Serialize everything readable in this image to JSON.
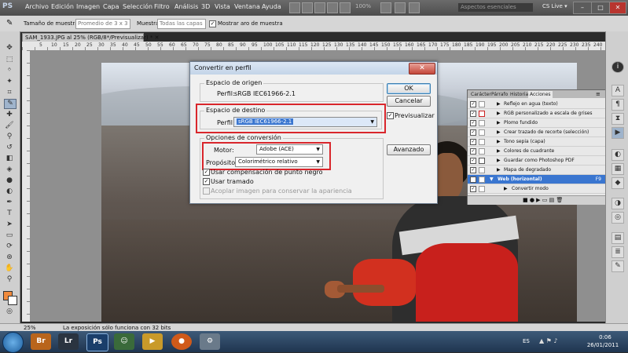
{
  "app": {
    "logo": "PS",
    "menu": [
      "Archivo",
      "Edición",
      "Imagen",
      "Capa",
      "Selección",
      "Filtro",
      "Análisis",
      "3D",
      "Vista",
      "Ventana",
      "Ayuda"
    ],
    "zoom": "100%",
    "workspace": "Aspectos esenciales",
    "cs_live": "CS Live ▾",
    "win_minimize": "–",
    "win_maximize": "□",
    "win_close": "✕"
  },
  "options": {
    "sample_size_label": "Tamaño de muestra:",
    "sample_size_value": "Promedio de 3 x 3",
    "sample_label": "Muestra:",
    "sample_value": "Todas las capas",
    "ring_label": "Mostrar aro de muestra",
    "ring_checked": "✓"
  },
  "document": {
    "tab": "SAM_1933.JPG al 25% (RGB/8*/Previsualizar) * ✕",
    "ruler_numbers": [
      "5",
      "10",
      "15",
      "20",
      "25",
      "30",
      "35",
      "40",
      "45",
      "50",
      "55",
      "60",
      "65",
      "70",
      "75",
      "80",
      "85",
      "90",
      "95",
      "100",
      "105",
      "110",
      "115",
      "120",
      "125",
      "130",
      "135",
      "140",
      "145",
      "150",
      "155",
      "160",
      "165",
      "170",
      "175",
      "180",
      "185",
      "190",
      "195",
      "200",
      "205",
      "210",
      "215",
      "220",
      "225",
      "230",
      "235",
      "240",
      "245"
    ]
  },
  "dialog": {
    "title": "Convertir en perfil",
    "close": "✕",
    "source_group": "Espacio de origen",
    "source_profile_label": "Perfil:",
    "source_profile_value": "sRGB IEC61966-2.1",
    "dest_group": "Espacio de destino",
    "dest_profile_label": "Perfil:",
    "dest_profile_value": "sRGB IEC61966-2.1",
    "conv_group": "Opciones de conversión",
    "engine_label": "Motor:",
    "engine_value": "Adobe (ACE)",
    "intent_label": "Propósito:",
    "intent_value": "Colorimétrico relativo",
    "bpc_label": "Usar compensación de punto negro",
    "dither_label": "Usar tramado",
    "flatten_label": "Acoplar imagen para conservar la apariencia",
    "ok": "OK",
    "cancel": "Cancelar",
    "preview_label": "Previsualizar",
    "advanced": "Avanzado",
    "check": "✓"
  },
  "actions_panel": {
    "tabs": [
      "Carácter",
      "Párrafo",
      "Historia",
      "Acciones"
    ],
    "items": [
      {
        "label": "Reflejo en agua (texto)",
        "tri": "▶"
      },
      {
        "label": "RGB personalizado a escala de grises",
        "tri": "▶"
      },
      {
        "label": "Plomo fundido",
        "tri": "▶"
      },
      {
        "label": "Crear trazado de recorte (selección)",
        "tri": "▶"
      },
      {
        "label": "Tono sepia (capa)",
        "tri": "▶"
      },
      {
        "label": "Colores de cuadrante",
        "tri": "▶"
      },
      {
        "label": "Guardar como Photoshop PDF",
        "tri": "▶"
      },
      {
        "label": "Mapa de degradado",
        "tri": "▶"
      },
      {
        "label": "Web (horizontal)",
        "tri": "▼",
        "shortcut": "F9"
      },
      {
        "label": "Convertir modo",
        "tri": "▶"
      }
    ],
    "check": "✓",
    "bottom_icons": "■  ●  ▶  ▭  ▤  🗑"
  },
  "status": {
    "zoom": "25%",
    "message": "La exposición sólo funciona con 32 bits"
  },
  "taskbar": {
    "apps": [
      "Br",
      "Lr",
      "Ps"
    ],
    "lang": "ES",
    "time": "0:06",
    "date": "26/01/2011"
  },
  "colors": {
    "accent_red": "#d9262c",
    "selection_blue": "#3a76d0",
    "foreground_swatch": "#f08a3c"
  }
}
